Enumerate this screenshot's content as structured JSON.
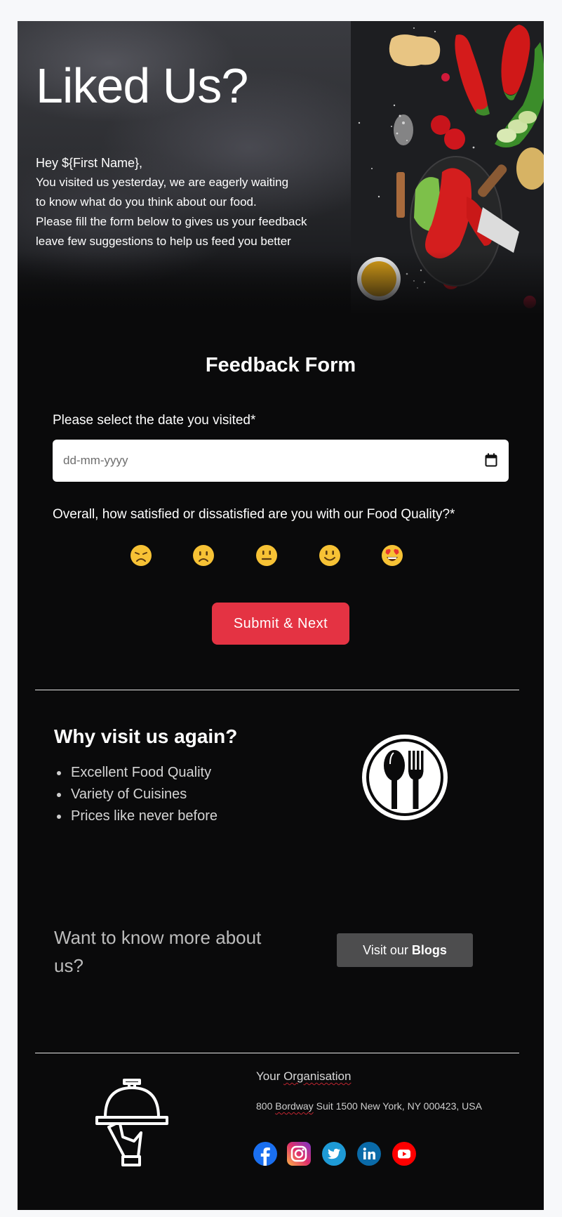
{
  "hero": {
    "title": "Liked Us?",
    "greeting": "Hey ${First Name},",
    "lines": [
      "You visited us yesterday, we are eagerly waiting",
      "to know what do you think about our food.",
      "Please fill the form below to gives us your feedback",
      "leave few suggestions to help us feed you better"
    ]
  },
  "form": {
    "title": "Feedback Form",
    "date_label": "Please select the date you visited*",
    "date_placeholder": "dd-mm-yyyy",
    "date_value": "",
    "rating_label": "Overall, how satisfied or dissatisfied are you with our Food Quality?*",
    "rating_options": [
      {
        "icon": "disappointed-face-icon",
        "label": "Very dissatisfied"
      },
      {
        "icon": "frowning-face-icon",
        "label": "Dissatisfied"
      },
      {
        "icon": "neutral-face-icon",
        "label": "Neutral"
      },
      {
        "icon": "smiling-face-icon",
        "label": "Satisfied"
      },
      {
        "icon": "heart-eyes-face-icon",
        "label": "Very satisfied"
      }
    ],
    "submit_label": "Submit & Next"
  },
  "why": {
    "title": "Why visit us again?",
    "items": [
      "Excellent Food Quality",
      "Variety of Cuisines",
      "Prices like never before"
    ]
  },
  "more": {
    "text": "Want to know more about us?",
    "button_prefix": "Visit our ",
    "button_bold": "Blogs"
  },
  "footer": {
    "org_prefix": "Your ",
    "org_underlined": "Organisation",
    "address_prefix": "800 ",
    "address_underlined": "Bordway",
    "address_suffix": " Suit 1500 New York, NY 000423, USA",
    "social": [
      {
        "name": "facebook",
        "color": "#1877f2"
      },
      {
        "name": "instagram",
        "color": "#d6249f"
      },
      {
        "name": "twitter",
        "color": "#1da1f2"
      },
      {
        "name": "linkedin",
        "color": "#0a66c2"
      },
      {
        "name": "youtube",
        "color": "#ff0000"
      }
    ]
  },
  "colors": {
    "accent": "#e43343",
    "background": "#0a0a0b",
    "secondary_button": "#4d4d4e"
  }
}
